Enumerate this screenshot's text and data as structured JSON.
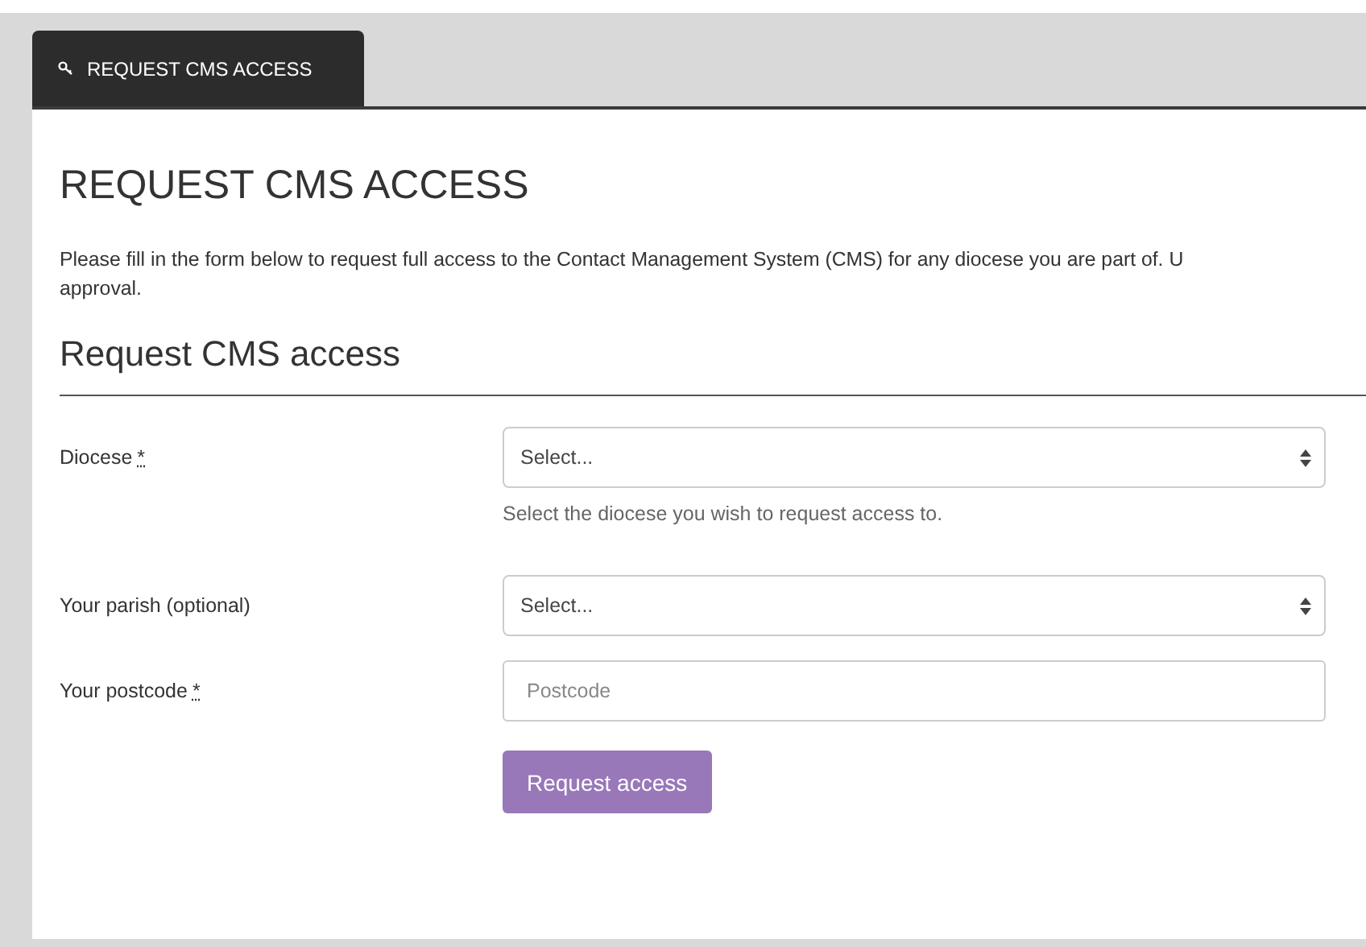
{
  "tabs": [
    {
      "label": "REQUEST CMS ACCESS",
      "selected": true
    }
  ],
  "page_title": "REQUEST CMS ACCESS",
  "intro": "Please fill in the form below to request full access to the Contact Management System (CMS) for any diocese you are part of. U\napproval.",
  "form_title": "Request CMS access",
  "fields": [
    {
      "kind": "select",
      "label": "Diocese",
      "required_mark": "*",
      "value": "Select...",
      "help": "Select the diocese you wish to request access to."
    },
    {
      "kind": "select",
      "label": "Your parish (optional)",
      "value": "Select..."
    },
    {
      "kind": "text",
      "label": "Your postcode",
      "required_mark": "*",
      "placeholder": "Postcode"
    }
  ],
  "submit": "Request access"
}
